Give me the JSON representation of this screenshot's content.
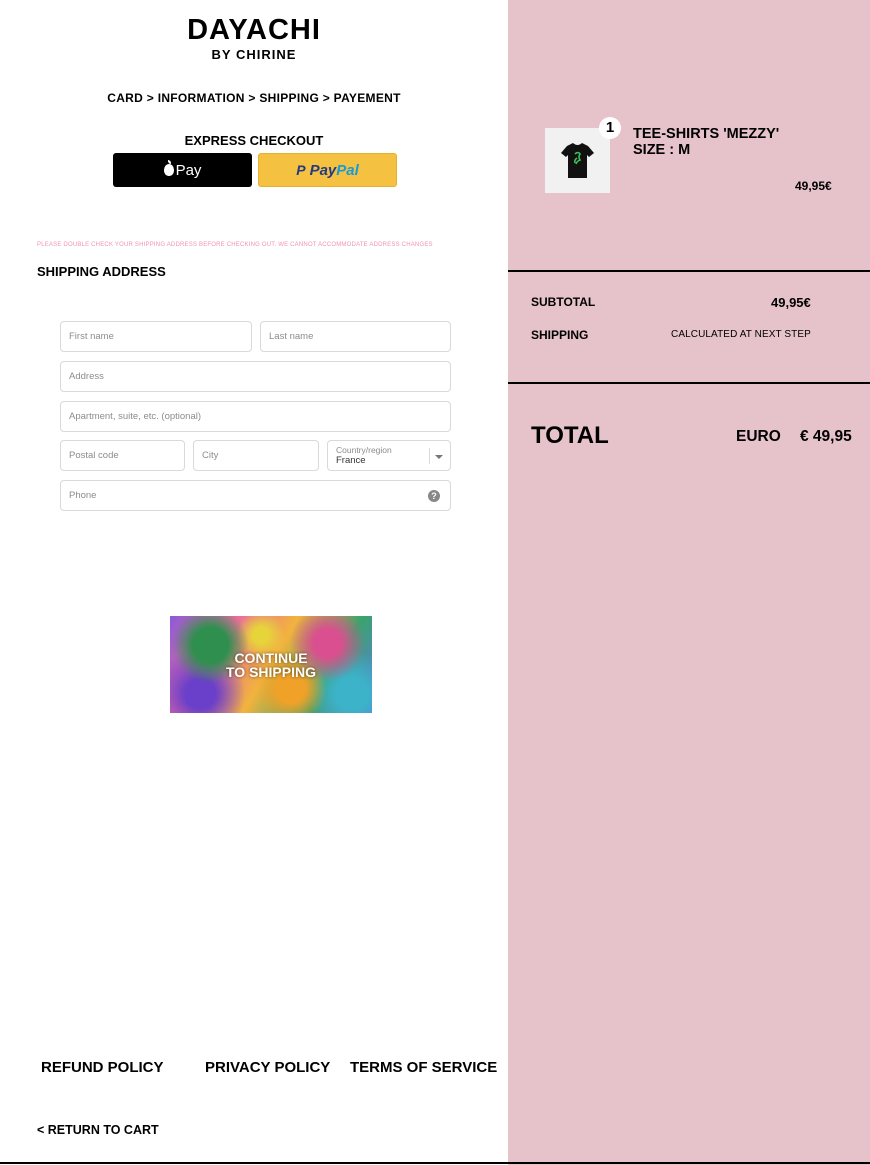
{
  "brand": {
    "name": "DAYACHI",
    "subtitle": "BY CHIRINE"
  },
  "breadcrumb": "CARD > INFORMATION > SHIPPING > PAYEMENT",
  "express_checkout": {
    "title": "EXPRESS CHECKOUT",
    "apple_pay_label": "Pay",
    "paypal_label_1": "Pay",
    "paypal_label_2": "Pal",
    "paypal_mark": "P"
  },
  "notice": "PLEASE DOUBLE CHECK YOUR SHIPPING ADDRESS BEFORE CHECKING OUT. WE CANNOT ACCOMMODATE ADDRESS CHANGES",
  "shipping": {
    "heading": "SHIPPING ADDRESS",
    "fields": {
      "first_name_placeholder": "First name",
      "last_name_placeholder": "Last name",
      "address_placeholder": "Address",
      "apartment_placeholder": "Apartment, suite, etc. (optional)",
      "postal_placeholder": "Postal code",
      "city_placeholder": "City",
      "country_label": "Country/region",
      "country_value": "France",
      "phone_placeholder": "Phone"
    },
    "help_glyph": "?"
  },
  "continue_button": {
    "label": "CONTINUE TO SHIPPING"
  },
  "footer": {
    "refund": "REFUND POLICY",
    "privacy": "PRIVACY POLICY",
    "terms": "TERMS OF SERVICE",
    "return": "< RETURN TO CART"
  },
  "order": {
    "item": {
      "quantity": "1",
      "name": "TEE-SHIRTS 'MEZZY'",
      "size": "SIZE : M",
      "price": "49,95€"
    },
    "subtotal_label": "SUBTOTAL",
    "subtotal_value": "49,95€",
    "shipping_label": "SHIPPING",
    "shipping_value": "CALCULATED AT NEXT STEP",
    "total_label": "TOTAL",
    "currency": "EURO",
    "total_value": "€ 49,95"
  },
  "colors": {
    "sidebar_bg": "#e6c2cb",
    "notice": "#f094b5",
    "paypal_yellow": "#f5c141",
    "paypal_blue": "#253b80",
    "paypal_light_blue": "#179bd7"
  },
  "icons": [
    "apple-icon",
    "paypal-icon",
    "chevron-down-icon",
    "help-icon",
    "tshirt-icon"
  ]
}
